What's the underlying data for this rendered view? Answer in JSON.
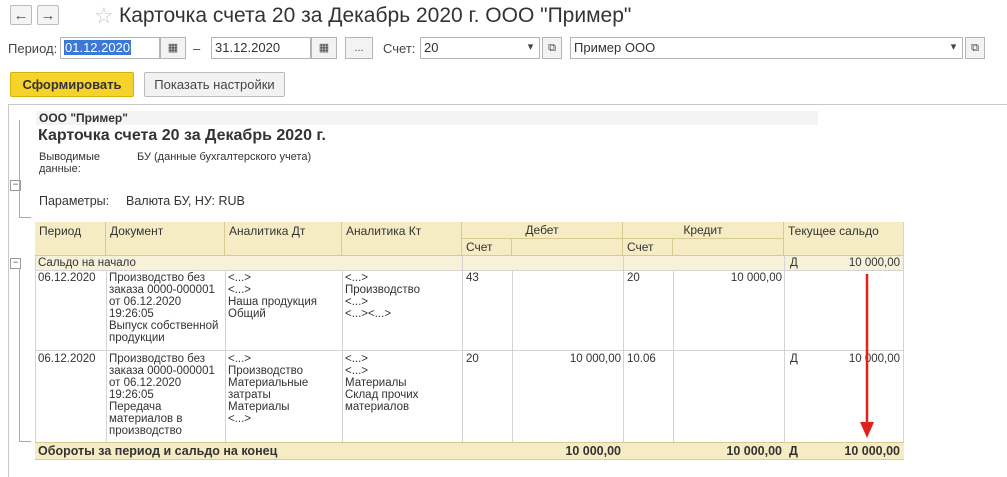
{
  "toolbar": {
    "back_glyph": "←",
    "forward_glyph": "→",
    "title": "Карточка счета 20 за Декабрь 2020 г. ООО \"Пример\""
  },
  "filters": {
    "period_label": "Период:",
    "period_from": "01.12.2020",
    "period_dash": "–",
    "period_to": "31.12.2020",
    "more_btn": "...",
    "account_label": "Счет:",
    "account_value": "20",
    "org_value": "Пример ООО"
  },
  "actions": {
    "generate": "Сформировать",
    "show_settings": "Показать настройки"
  },
  "report": {
    "org": "ООО \"Пример\"",
    "heading": "Карточка счета 20 за Декабрь 2020 г.",
    "data_label": "Выводимые данные:",
    "data_value": "БУ (данные бухгалтерского учета)",
    "params_label": "Параметры:",
    "params_value": "Валюта БУ, НУ: RUB",
    "columns": {
      "period": "Период",
      "document": "Документ",
      "analytics_dt": "Аналитика Дт",
      "analytics_kt": "Аналитика Кт",
      "debit": "Дебет",
      "credit": "Кредит",
      "balance": "Текущее сальдо",
      "account": "Счет"
    },
    "opening": {
      "label": "Сальдо на начало",
      "side": "Д",
      "amount": "10 000,00"
    },
    "rows": [
      {
        "period": "06.12.2020",
        "document": [
          "Производство без",
          "заказа 0000-000001",
          "от 06.12.2020",
          "19:26:05",
          "Выпуск собственной",
          "продукции"
        ],
        "analytics_dt": [
          "<...>",
          "<...>",
          "Наша продукция",
          "Общий"
        ],
        "analytics_kt": [
          "<...>",
          "Производство",
          "<...>",
          "<...><...>"
        ],
        "debit_account": "43",
        "debit_amount": "",
        "credit_account": "20",
        "credit_amount": "10 000,00",
        "balance_side": "",
        "balance_amount": ""
      },
      {
        "period": "06.12.2020",
        "document": [
          "Производство без",
          "заказа 0000-000001",
          "от 06.12.2020",
          "19:26:05",
          "Передача",
          "материалов в",
          "производство"
        ],
        "analytics_dt": [
          "<...>",
          "Производство",
          "Материальные",
          "затраты",
          "Материалы",
          "<...>"
        ],
        "analytics_kt": [
          "<...>",
          "<...>",
          "Материалы",
          "Склад прочих",
          "материалов"
        ],
        "debit_account": "20",
        "debit_amount": "10 000,00",
        "credit_account": "10.06",
        "credit_amount": "",
        "balance_side": "Д",
        "balance_amount": "10 000,00"
      }
    ],
    "totals": {
      "label": "Обороты за период и сальдо на конец",
      "debit": "10 000,00",
      "credit": "10 000,00",
      "side": "Д",
      "balance": "10 000,00"
    }
  },
  "annotation": {
    "arrow_color": "#e0201b"
  }
}
